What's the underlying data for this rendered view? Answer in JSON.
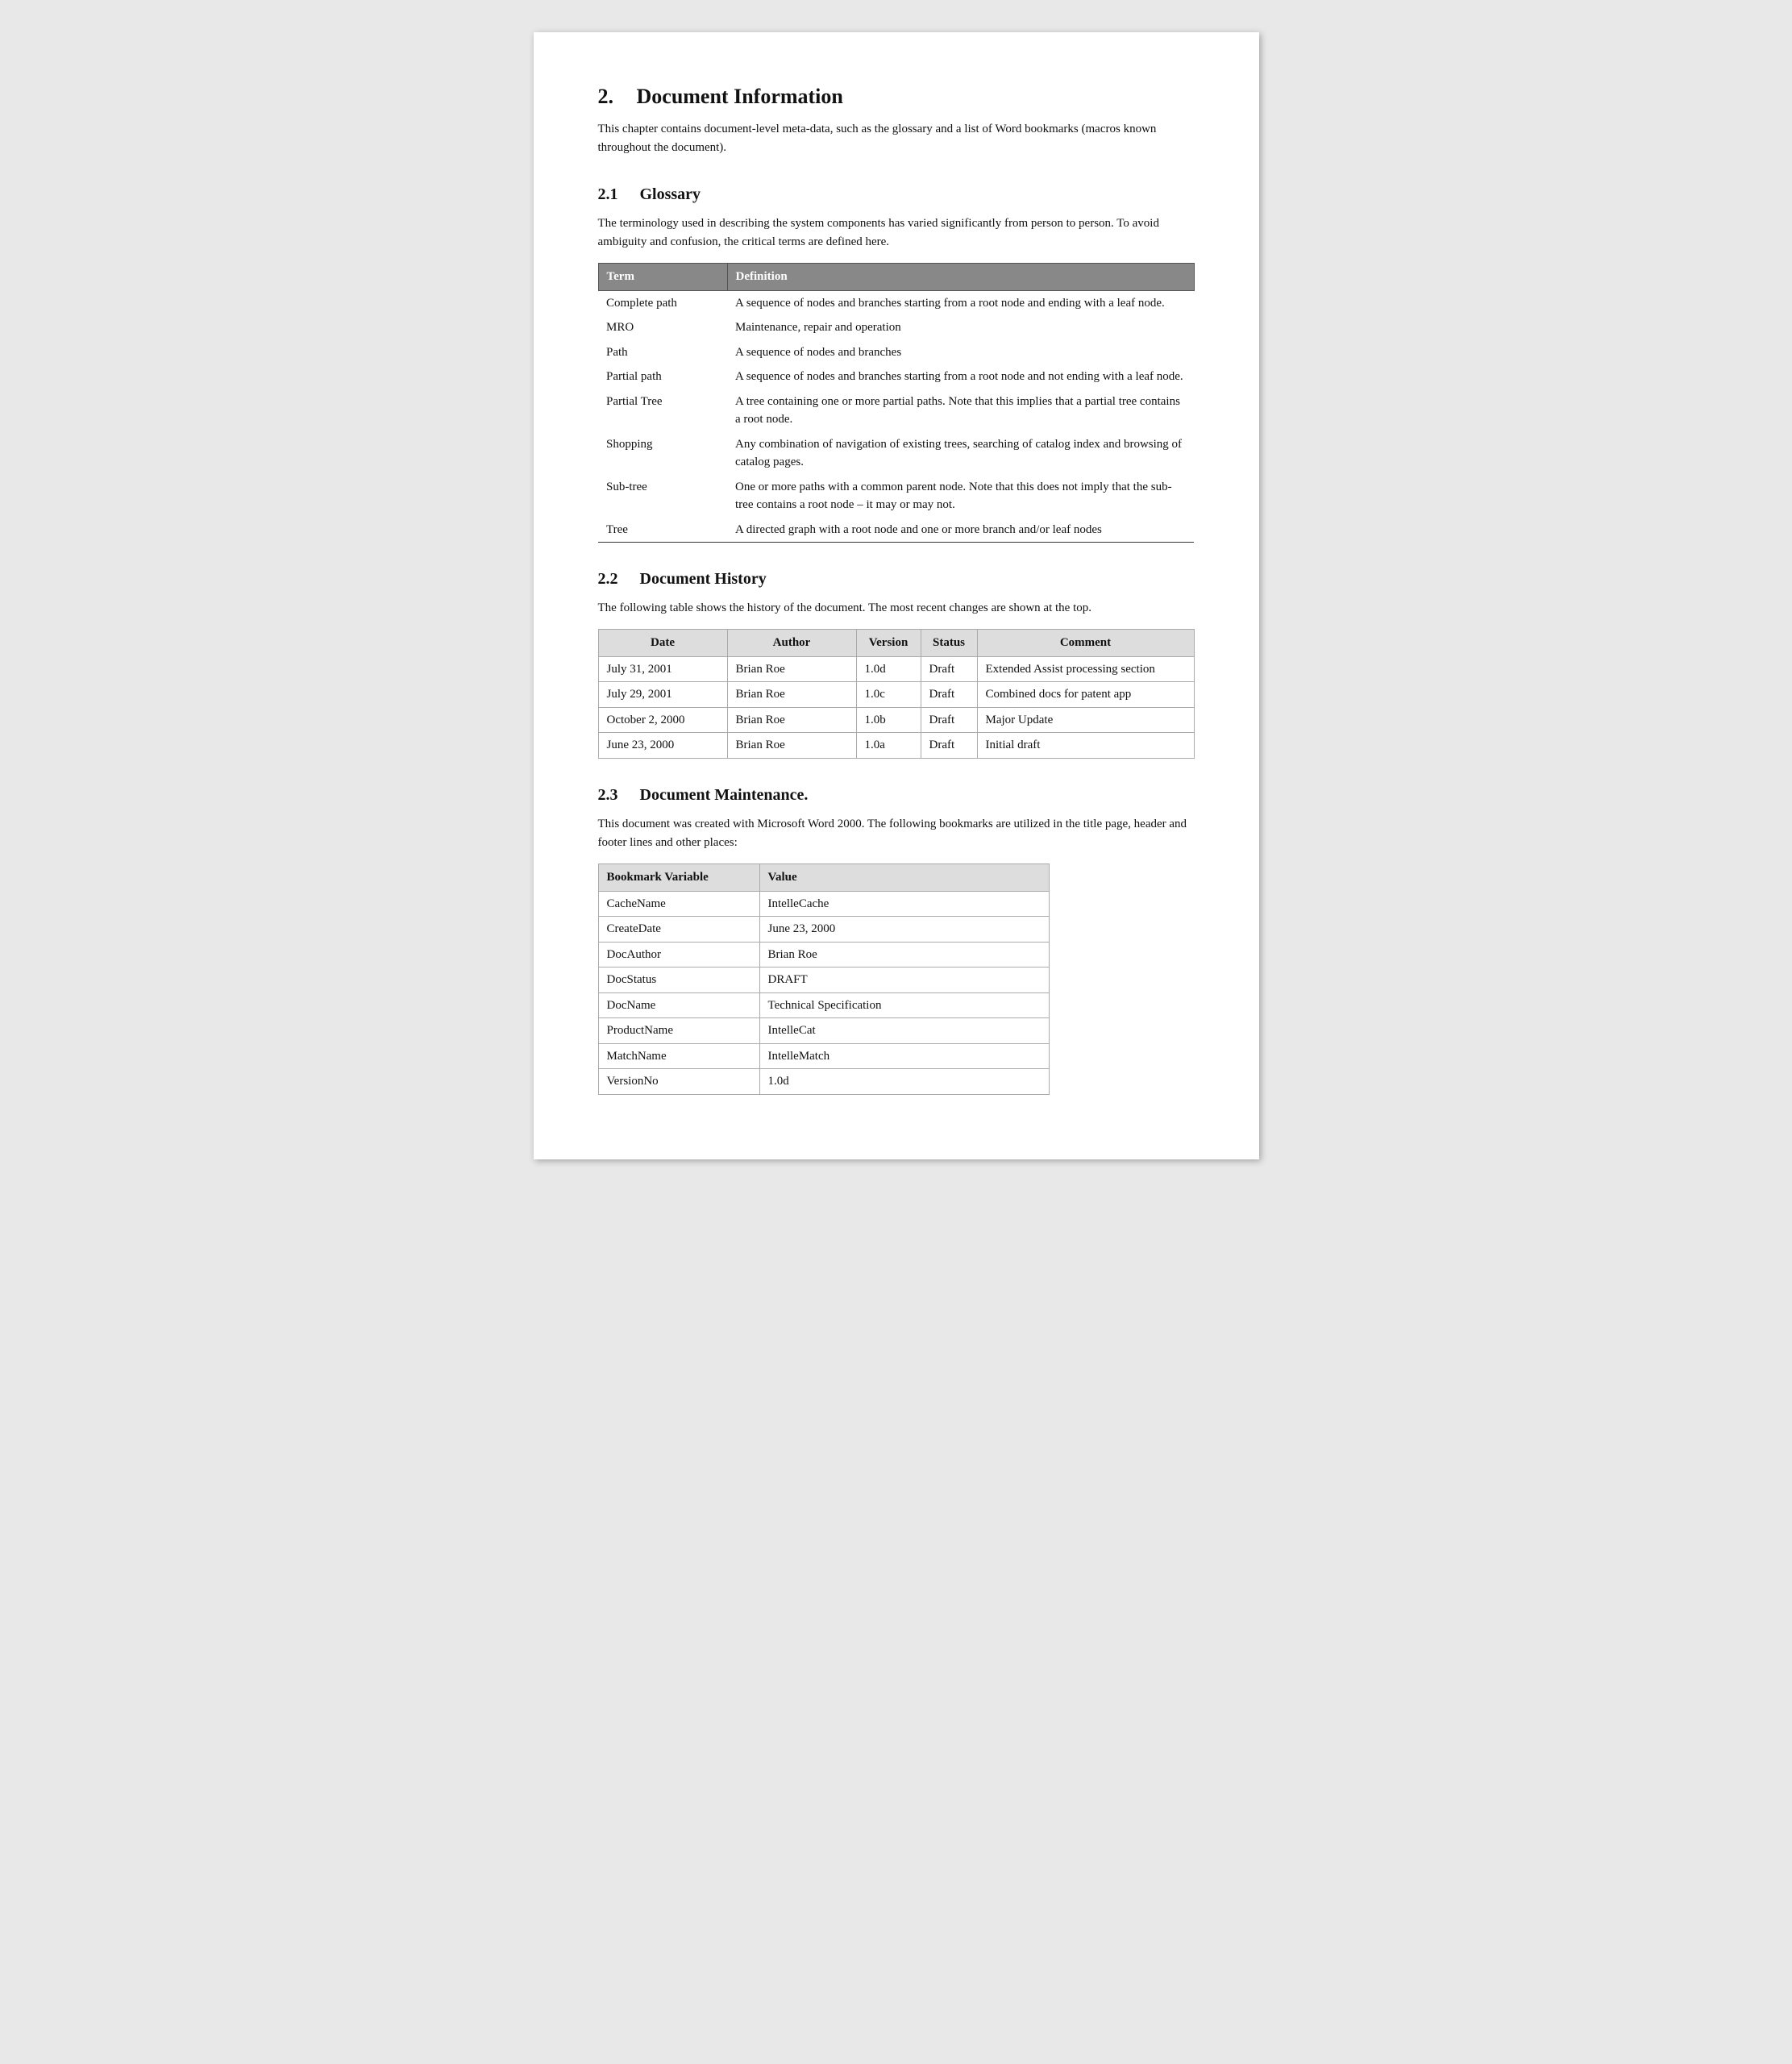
{
  "section2": {
    "title_num": "2.",
    "title_text": "Document Information",
    "intro": "This chapter contains document-level meta-data, such as the glossary and a list of Word bookmarks (macros known throughout the document)."
  },
  "section2_1": {
    "title_num": "2.1",
    "title_text": "Glossary",
    "intro": "The terminology used in describing the system components has varied significantly from person to person.  To avoid ambiguity and confusion, the critical terms are defined here.",
    "table_headers": [
      "Term",
      "Definition"
    ],
    "rows": [
      {
        "term": "Complete path",
        "definition": "A sequence of nodes and branches starting from a root node and ending with a leaf node."
      },
      {
        "term": "MRO",
        "definition": "Maintenance, repair and operation"
      },
      {
        "term": "Path",
        "definition": "A sequence of nodes and branches"
      },
      {
        "term": "Partial path",
        "definition": "A sequence of nodes and branches starting from a root node and not ending with a leaf node."
      },
      {
        "term": "Partial Tree",
        "definition": "A tree containing one or more partial paths.  Note that this implies that a partial tree contains a root node."
      },
      {
        "term": "Shopping",
        "definition": "Any combination of navigation of existing trees, searching of catalog index and browsing of catalog pages."
      },
      {
        "term": "Sub-tree",
        "definition": "One or more paths with a common parent node.  Note that this does not imply that the sub-tree contains a root node – it may or may not."
      },
      {
        "term": "Tree",
        "definition": "A directed graph with a root node and one or more branch and/or leaf nodes"
      }
    ]
  },
  "section2_2": {
    "title_num": "2.2",
    "title_text": "Document History",
    "intro": "The following table shows the history of the document.  The most recent changes are shown at the top.",
    "table_headers": [
      "Date",
      "Author",
      "Version",
      "Status",
      "Comment"
    ],
    "rows": [
      {
        "date": "July 31, 2001",
        "author": "Brian Roe",
        "version": "1.0d",
        "status": "Draft",
        "comment": "Extended Assist processing section"
      },
      {
        "date": "July 29, 2001",
        "author": "Brian Roe",
        "version": "1.0c",
        "status": "Draft",
        "comment": "Combined docs for patent app"
      },
      {
        "date": "October 2, 2000",
        "author": "Brian Roe",
        "version": "1.0b",
        "status": "Draft",
        "comment": "Major Update"
      },
      {
        "date": "June 23, 2000",
        "author": "Brian Roe",
        "version": "1.0a",
        "status": "Draft",
        "comment": "Initial draft"
      }
    ]
  },
  "section2_3": {
    "title_num": "2.3",
    "title_text": "Document Maintenance.",
    "intro": "This document was created with Microsoft Word 2000. The following bookmarks are utilized in the title page, header and footer lines and other places:",
    "table_headers": [
      "Bookmark Variable",
      "Value"
    ],
    "rows": [
      {
        "variable": "CacheName",
        "value": "IntelleCache"
      },
      {
        "variable": "CreateDate",
        "value": "June 23, 2000"
      },
      {
        "variable": "DocAuthor",
        "value": "Brian Roe"
      },
      {
        "variable": "DocStatus",
        "value": "DRAFT"
      },
      {
        "variable": "DocName",
        "value": "Technical Specification"
      },
      {
        "variable": "ProductName",
        "value": "IntelleCat"
      },
      {
        "variable": "MatchName",
        "value": "IntelleMatch"
      },
      {
        "variable": "VersionNo",
        "value": "1.0d"
      }
    ]
  }
}
